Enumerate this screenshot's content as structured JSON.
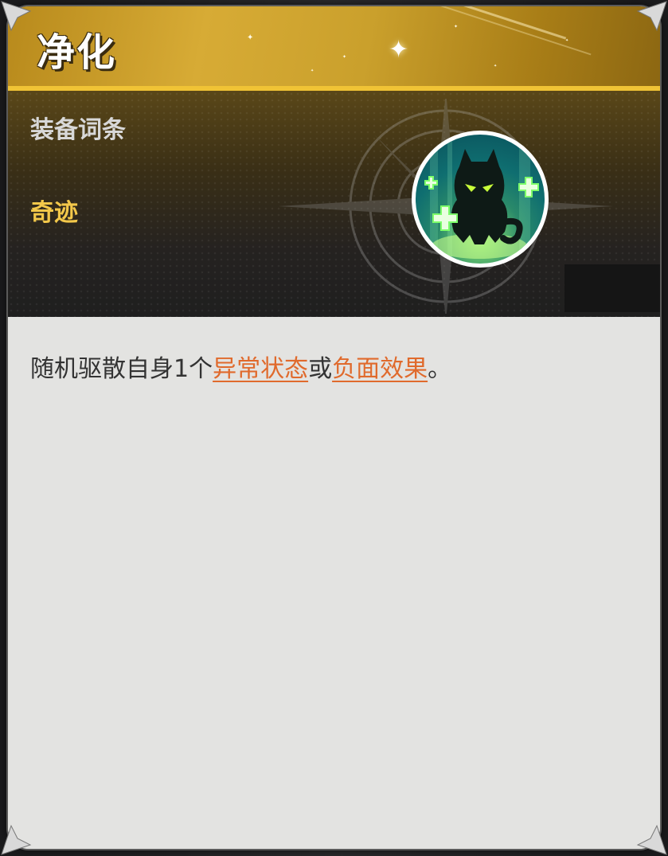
{
  "card": {
    "title": "净化",
    "section_label": "装备词条",
    "rarity": "奇迹",
    "icon_name": "purify-skill-icon",
    "description": {
      "prefix": "随机驱散自身1个",
      "keyword_1": "异常状态",
      "connector": "或",
      "keyword_2": "负面效果",
      "suffix": "。"
    }
  },
  "colors": {
    "title_gold": "#d7ab35",
    "rarity_gold": "#f3c84a",
    "keyword_orange": "#e06a2c",
    "body_bg": "#e3e3e1"
  }
}
